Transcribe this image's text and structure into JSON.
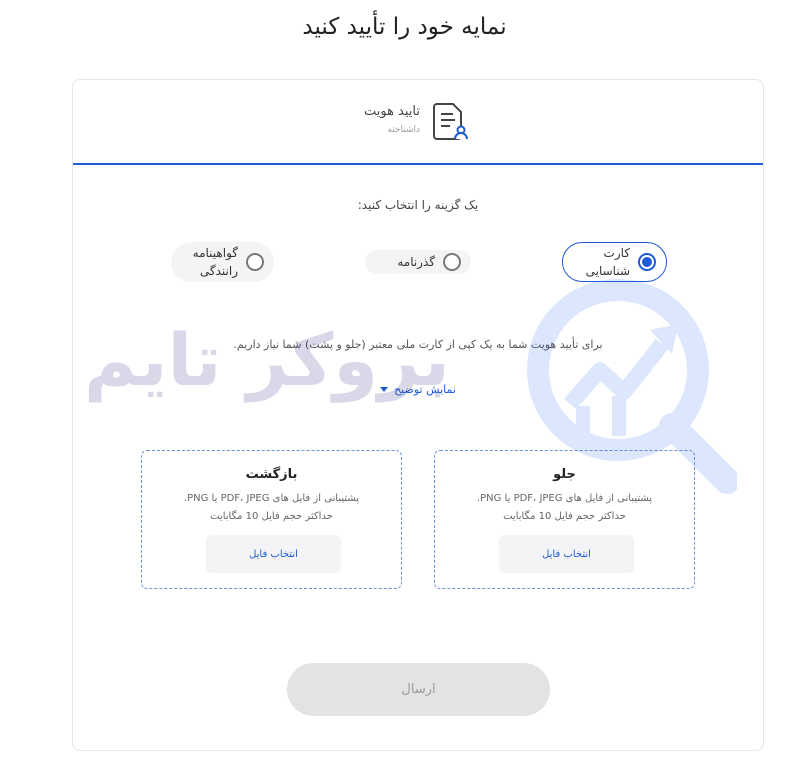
{
  "page": {
    "title": "نمایه خود را تأیید کنید"
  },
  "step": {
    "title": "تایید هویت",
    "subtitle": "داشناخته"
  },
  "selection": {
    "prompt": "یک گزینه را انتخاب کنید:",
    "options": [
      {
        "label": "کارت شناسایی",
        "selected": true
      },
      {
        "label": "گذرنامه",
        "selected": false
      },
      {
        "label": "گواهینامه رانندگی",
        "selected": false
      }
    ]
  },
  "info": {
    "text": "برای تأیید هویت شما به یک کپی از کارت ملی معتبر (جلو و پشت) شما نیاز داریم.",
    "toggle_label": "نمایش توضیح"
  },
  "uploads": [
    {
      "title": "جلو",
      "desc": "پشتیبانی از فایل های PDF، JPEG یا PNG.",
      "limit": "حداکثر حجم فایل 10 مگابایت",
      "button": "انتخاب فایل"
    },
    {
      "title": "بازگشت",
      "desc": "پشتیبانی از فایل های PDF، JPEG یا PNG.",
      "limit": "حداکثر حجم فایل 10 مگابایت",
      "button": "انتخاب فایل"
    }
  ],
  "submit": {
    "label": "ارسال"
  },
  "watermark": {
    "text": "بروکر تایم"
  },
  "colors": {
    "accent": "#1e5bd6",
    "watermark": "#2e2e84"
  }
}
